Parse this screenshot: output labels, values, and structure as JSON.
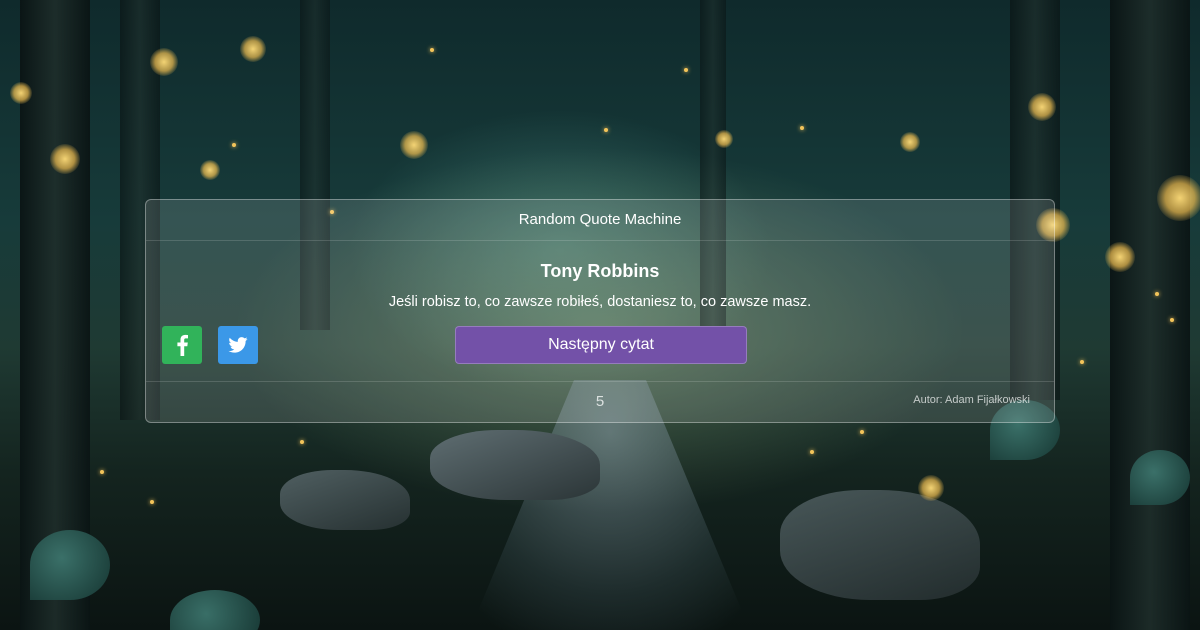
{
  "app": {
    "title": "Random Quote Machine"
  },
  "quote": {
    "author": "Tony Robbins",
    "text": "Jeśli robisz to, co zawsze robiłeś, dostaniesz to, co zawsze masz."
  },
  "actions": {
    "next_label": "Następny cytat",
    "share_facebook_icon": "facebook-icon",
    "share_twitter_icon": "twitter-icon"
  },
  "footer": {
    "counter": "5",
    "credit": "Autor: Adam Fijałkowski"
  },
  "colors": {
    "accent_button": "#7351a8",
    "facebook": "#31b35a",
    "twitter": "#3b98e8"
  }
}
